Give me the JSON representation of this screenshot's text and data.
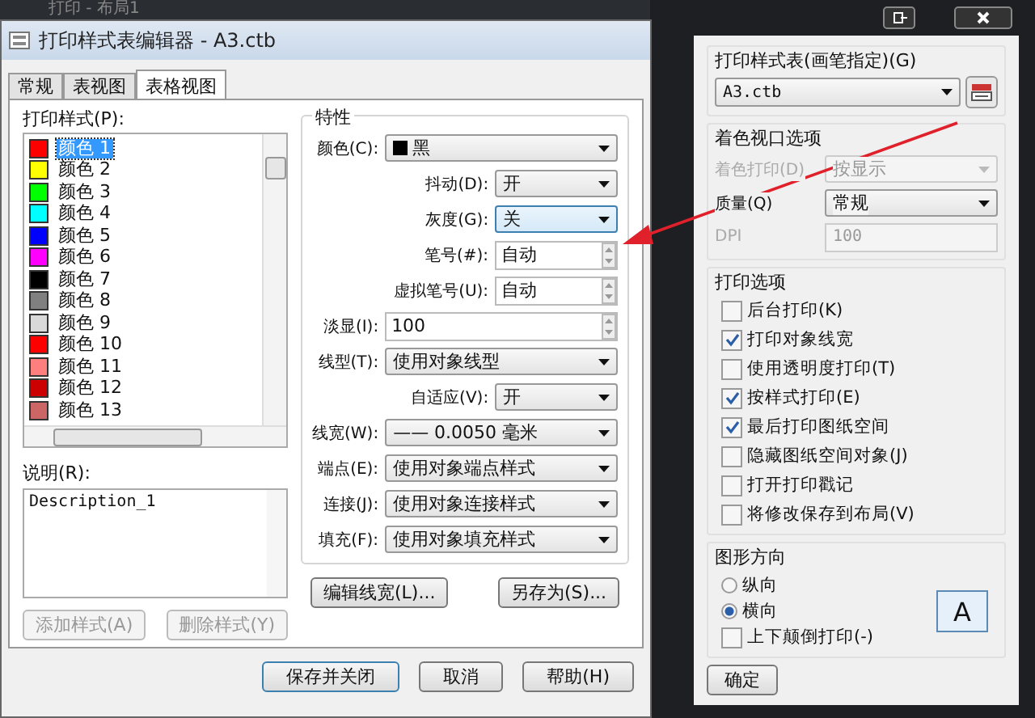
{
  "back_window": {
    "title": "打印 - 布局1"
  },
  "editor": {
    "title": "打印样式表编辑器 - A3.ctb",
    "tabs": [
      {
        "label": "常规",
        "selected": false
      },
      {
        "label": "表视图",
        "selected": false
      },
      {
        "label": "表格视图",
        "selected": true
      }
    ],
    "styles_label": "打印样式(P):",
    "styles": [
      {
        "name": "颜色 1",
        "color": "#ff0000",
        "selected": true
      },
      {
        "name": "颜色 2",
        "color": "#ffff00",
        "selected": false
      },
      {
        "name": "颜色 3",
        "color": "#00ff00",
        "selected": false
      },
      {
        "name": "颜色 4",
        "color": "#00ffff",
        "selected": false
      },
      {
        "name": "颜色 5",
        "color": "#0000ff",
        "selected": false
      },
      {
        "name": "颜色 6",
        "color": "#ff00ff",
        "selected": false
      },
      {
        "name": "颜色 7",
        "color": "#000000",
        "selected": false
      },
      {
        "name": "颜色 8",
        "color": "#808080",
        "selected": false
      },
      {
        "name": "颜色 9",
        "color": "#d9d9d9",
        "selected": false
      },
      {
        "name": "颜色 10",
        "color": "#ff0000",
        "selected": false
      },
      {
        "name": "颜色 11",
        "color": "#ff7f7f",
        "selected": false
      },
      {
        "name": "颜色 12",
        "color": "#cc0000",
        "selected": false
      },
      {
        "name": "颜色 13",
        "color": "#cc6666",
        "selected": false
      }
    ],
    "description_label": "说明(R):",
    "description": "Description_1",
    "style_buttons": [
      {
        "label": "添加样式(A)",
        "disabled": true
      },
      {
        "label": "删除样式(Y)",
        "disabled": true
      }
    ],
    "properties": {
      "title": "特性",
      "rows": [
        {
          "kind": "select",
          "label": "颜色(C):",
          "value": "黑"
        },
        {
          "kind": "toggle",
          "label": "抖动(D):",
          "value": "开",
          "focused": false
        },
        {
          "kind": "toggle",
          "label": "灰度(G):",
          "value": "关",
          "focused": true
        },
        {
          "kind": "spinner",
          "label": "笔号(#):",
          "value": "自动"
        },
        {
          "kind": "spinner",
          "label": "虚拟笔号(U):",
          "value": "自动"
        },
        {
          "kind": "spin-field",
          "label": "淡显(I):",
          "value": "100"
        },
        {
          "kind": "select",
          "label": "线型(T):",
          "value": "使用对象线型"
        },
        {
          "kind": "toggle",
          "label": "自适应(V):",
          "value": "开",
          "focused": false
        },
        {
          "kind": "select",
          "label": "线宽(W):",
          "value": "—— 0.0050 毫米"
        },
        {
          "kind": "select",
          "label": "端点(E):",
          "value": "使用对象端点样式"
        },
        {
          "kind": "select",
          "label": "连接(J):",
          "value": "使用对象连接样式"
        },
        {
          "kind": "select",
          "label": "填充(F):",
          "value": "使用对象填充样式"
        }
      ]
    },
    "edit_buttons": [
      "编辑线宽(L)...",
      "另存为(S)..."
    ],
    "footer_buttons": [
      "保存并关闭",
      "取消",
      "帮助(H)"
    ]
  },
  "print_dialog": {
    "plot_style_label": "打印样式表(画笔指定)(G)",
    "plot_style": "A3.ctb",
    "shaded_viewport": {
      "title": "着色视口选项",
      "rows": [
        {
          "kind": "select",
          "label": "着色打印(D)",
          "value": "按显示",
          "disabled": true
        },
        {
          "kind": "select",
          "label": "质量(Q)",
          "value": "常规",
          "disabled": false
        },
        {
          "kind": "input",
          "label": "DPI",
          "value": "100",
          "disabled": true
        }
      ]
    },
    "options": {
      "title": "打印选项",
      "items": [
        {
          "label": "后台打印(K)",
          "checked": false
        },
        {
          "label": "打印对象线宽",
          "checked": true
        },
        {
          "label": "使用透明度打印(T)",
          "checked": false
        },
        {
          "label": "按样式打印(E)",
          "checked": true
        },
        {
          "label": "最后打印图纸空间",
          "checked": true
        },
        {
          "label": "隐藏图纸空间对象(J)",
          "checked": false
        },
        {
          "label": "打开打印戳记",
          "checked": false
        },
        {
          "label": "将修改保存到布局(V)",
          "checked": false
        }
      ]
    },
    "orientation": {
      "title": "图形方向",
      "radios": [
        {
          "label": "纵向",
          "selected": false
        },
        {
          "label": "横向",
          "selected": true
        }
      ],
      "upside_down": {
        "label": "上下颠倒打印(-)",
        "checked": false
      },
      "preview": "A"
    },
    "ok_button": "确定"
  }
}
